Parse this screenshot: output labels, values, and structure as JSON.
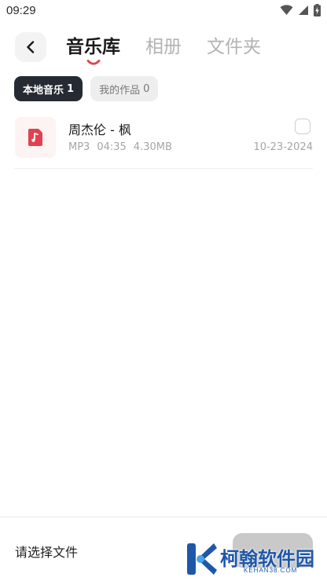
{
  "status_bar": {
    "time": "09:29",
    "icons": [
      "wifi-icon",
      "cellular-signal-icon",
      "battery-charging-icon"
    ]
  },
  "header": {
    "back_icon": "chevron-left-icon",
    "tabs": [
      {
        "label": "音乐库",
        "active": true
      },
      {
        "label": "相册",
        "active": false
      },
      {
        "label": "文件夹",
        "active": false
      }
    ]
  },
  "filters": [
    {
      "label": "本地音乐",
      "count": "1",
      "active": true
    },
    {
      "label": "我的作品",
      "count": "0",
      "active": false
    }
  ],
  "files": [
    {
      "title": "周杰伦 - 枫",
      "format": "MP3",
      "duration": "04:35",
      "size": "4.30MB",
      "date": "10-23-2024",
      "icon": "music-file-icon",
      "selected": false
    }
  ],
  "bottom_bar": {
    "prompt": "请选择文件"
  },
  "watermark": {
    "title": "柯翰软件园",
    "domain": "KEHAN38.COM"
  },
  "colors": {
    "accent": "#e0424f",
    "chip_active_bg": "#262a33",
    "watermark_blue": "#1e57a8"
  }
}
